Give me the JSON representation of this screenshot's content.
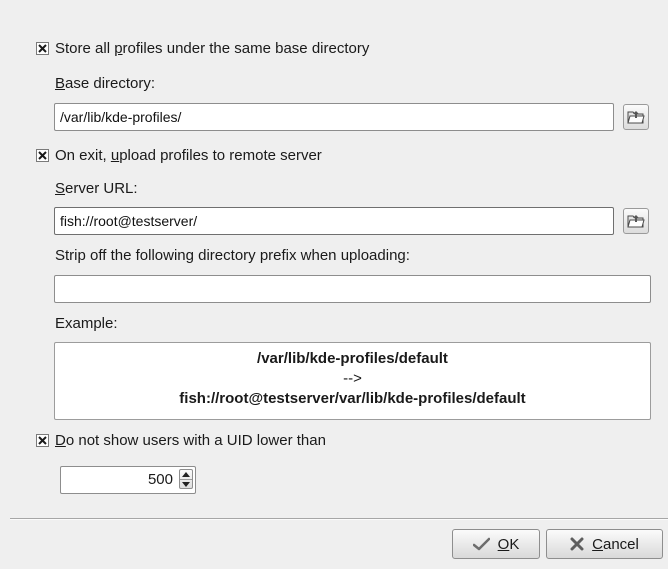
{
  "store_profiles": {
    "checked": true,
    "label_pre": "Store all ",
    "label_mnemonic": "p",
    "label_post": "rofiles under the same base directory"
  },
  "base_directory": {
    "label_mnemonic": "B",
    "label_rest": "ase directory:",
    "value": "/var/lib/kde-profiles/",
    "browse_icon": "folder-open-icon"
  },
  "upload_on_exit": {
    "checked": true,
    "label_pre": "On exit, ",
    "label_mnemonic": "u",
    "label_post": "pload profiles to remote server"
  },
  "server_url": {
    "label_mnemonic": "S",
    "label_rest": "erver URL:",
    "value": "fish://root@testserver/",
    "browse_icon": "folder-open-icon"
  },
  "strip_prefix": {
    "label": "Strip off the following directory prefix when uploading:",
    "value": ""
  },
  "example": {
    "label": "Example:",
    "line1": "/var/lib/kde-profiles/default",
    "line2": "-->",
    "line3": "fish://root@testserver/var/lib/kde-profiles/default"
  },
  "hide_low_uid": {
    "checked": true,
    "label_mnemonic": "D",
    "label_rest": "o not show users with a UID lower than"
  },
  "uid_min": {
    "value": "500"
  },
  "buttons": {
    "ok_mnemonic": "O",
    "ok_rest": "K",
    "ok_icon": "checkmark-icon",
    "cancel_mnemonic": "C",
    "cancel_rest": "ancel",
    "cancel_icon": "cancel-x-icon"
  }
}
